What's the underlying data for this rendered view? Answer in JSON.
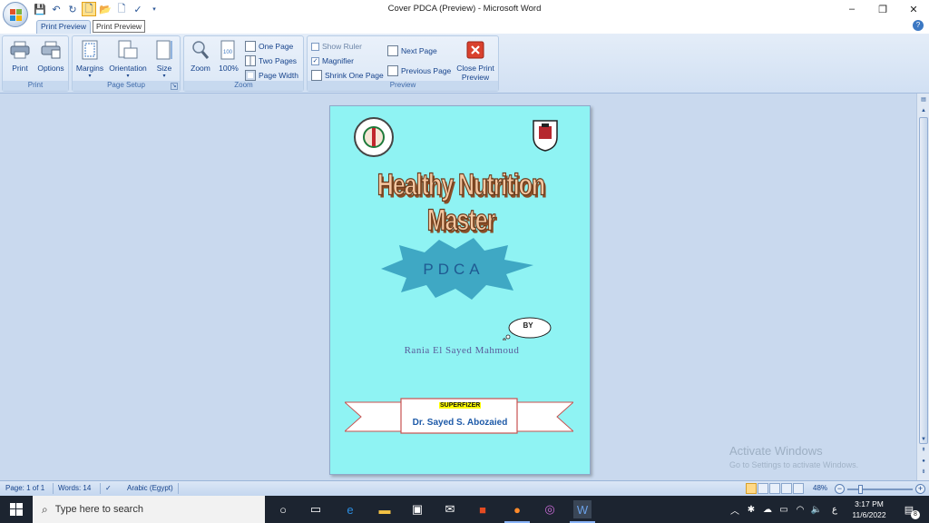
{
  "window": {
    "title": "Cover PDCA (Preview) - Microsoft Word",
    "minimize_glyph": "–",
    "restore_glyph": "❐",
    "close_glyph": "✕"
  },
  "tabs": {
    "active": "Print Preview",
    "tooltip": "Print Preview"
  },
  "ribbon": {
    "print_group": {
      "label": "Print",
      "print": "Print",
      "options": "Options"
    },
    "page_setup_group": {
      "label": "Page Setup",
      "margins": "Margins",
      "orientation": "Orientation",
      "size": "Size"
    },
    "zoom_group": {
      "label": "Zoom",
      "zoom": "Zoom",
      "hundred": "100%",
      "one_page": "One Page",
      "two_pages": "Two Pages",
      "page_width": "Page Width"
    },
    "preview_group": {
      "label": "Preview",
      "show_ruler": "Show Ruler",
      "show_ruler_checked": false,
      "magnifier": "Magnifier",
      "magnifier_checked": true,
      "shrink_one_page": "Shrink One Page",
      "next_page": "Next Page",
      "previous_page": "Previous Page",
      "close_print_preview_line1": "Close Print",
      "close_print_preview_line2": "Preview"
    }
  },
  "document": {
    "title": "Healthy Nutrition Master",
    "burst_text": "PDCA",
    "cloud_text": "BY",
    "author": "Rania El Sayed Mahmoud",
    "supervisor_label": "SUPERFIZER",
    "supervisor_name": "Dr. Sayed S. Abozaied"
  },
  "watermark": {
    "line1": "Activate Windows",
    "line2": "Go to Settings to activate Windows."
  },
  "status": {
    "page": "Page: 1 of 1",
    "words": "Words: 14",
    "language": "Arabic (Egypt)",
    "zoom": "48%"
  },
  "taskbar": {
    "search_placeholder": "Type here to search",
    "time": "3:17 PM",
    "date": "11/6/2022",
    "lang_indicator": "ع",
    "notif_count": "8"
  },
  "colors": {
    "page_bg": "#8ff3f3",
    "burst": "#3fa8c4",
    "ribbon_bg": "#dbe7f6",
    "taskbar": "#1c2430"
  }
}
